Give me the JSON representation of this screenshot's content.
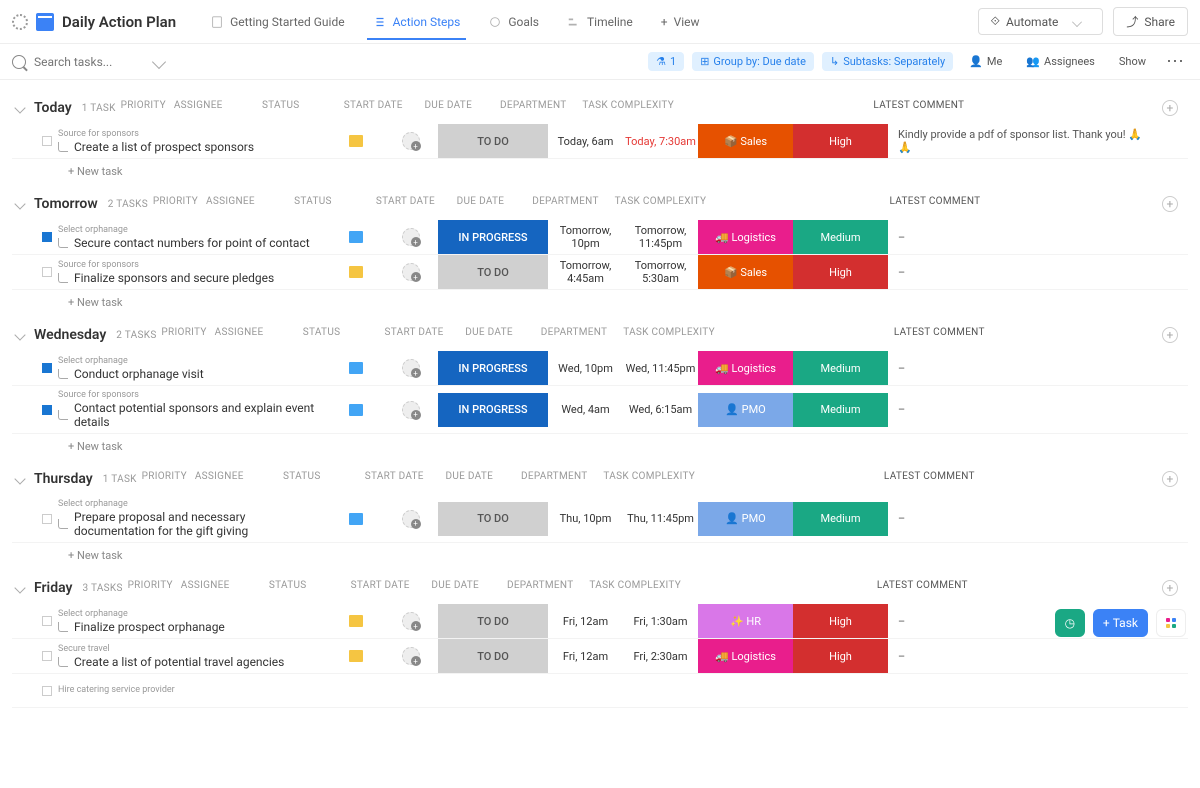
{
  "header": {
    "title": "Daily Action Plan",
    "tabs": [
      {
        "label": "Getting Started Guide"
      },
      {
        "label": "Action Steps"
      },
      {
        "label": "Goals"
      },
      {
        "label": "Timeline"
      },
      {
        "label": "View"
      }
    ],
    "automate": "Automate",
    "share": "Share"
  },
  "toolbar": {
    "search_placeholder": "Search tasks...",
    "filter_count": "1",
    "group_by": "Group by: Due date",
    "subtasks": "Subtasks: Separately",
    "me": "Me",
    "assignees": "Assignees",
    "show": "Show"
  },
  "columns": {
    "priority": "PRIORITY",
    "assignee": "ASSIGNEE",
    "status": "STATUS",
    "start": "START DATE",
    "due": "DUE DATE",
    "dept": "DEPARTMENT",
    "complexity": "TASK COMPLEXITY",
    "comment": "LATEST COMMENT"
  },
  "new_task": "+ New task",
  "groups": [
    {
      "title": "Today",
      "count": "1 TASK",
      "tasks": [
        {
          "parent": "Source for sponsors",
          "title": "Create a list of prospect sponsors",
          "flag": "yellow",
          "status": "TO DO",
          "status_cls": "st-todo",
          "start": "Today, 6am",
          "due": "Today, 7:30am",
          "due_red": true,
          "dept": "📦 Sales",
          "dept_cls": "dept-sales",
          "cx": "High",
          "cx_cls": "cx-high",
          "comment": "Kindly provide a pdf of sponsor list. Thank you! 🙏 🙏"
        }
      ]
    },
    {
      "title": "Tomorrow",
      "count": "2 TASKS",
      "tasks": [
        {
          "parent": "Select orphanage",
          "title": "Secure contact numbers for point of contact",
          "flag": "blue",
          "sq_blue": true,
          "status": "IN PROGRESS",
          "status_cls": "st-prog",
          "start": "Tomorrow, 10pm",
          "due": "Tomorrow, 11:45pm",
          "dept": "🚚 Logistics",
          "dept_cls": "dept-log",
          "cx": "Medium",
          "cx_cls": "cx-med",
          "comment": "–"
        },
        {
          "parent": "Source for sponsors",
          "title": "Finalize sponsors and secure pledges",
          "flag": "yellow",
          "status": "TO DO",
          "status_cls": "st-todo",
          "start": "Tomorrow, 4:45am",
          "due": "Tomorrow, 5:30am",
          "dept": "📦 Sales",
          "dept_cls": "dept-sales",
          "cx": "High",
          "cx_cls": "cx-high",
          "comment": "–"
        }
      ]
    },
    {
      "title": "Wednesday",
      "count": "2 TASKS",
      "tasks": [
        {
          "parent": "Select orphanage",
          "title": "Conduct orphanage visit",
          "flag": "blue",
          "sq_blue": true,
          "status": "IN PROGRESS",
          "status_cls": "st-prog",
          "start": "Wed, 10pm",
          "due": "Wed, 11:45pm",
          "dept": "🚚 Logistics",
          "dept_cls": "dept-log",
          "cx": "Medium",
          "cx_cls": "cx-med",
          "comment": "–"
        },
        {
          "parent": "Source for sponsors",
          "title": "Contact potential sponsors and explain event details",
          "flag": "blue",
          "sq_blue": true,
          "status": "IN PROGRESS",
          "status_cls": "st-prog",
          "start": "Wed, 4am",
          "due": "Wed, 6:15am",
          "dept": "👤 PMO",
          "dept_cls": "dept-pmo",
          "cx": "Medium",
          "cx_cls": "cx-med",
          "comment": "–"
        }
      ]
    },
    {
      "title": "Thursday",
      "count": "1 TASK",
      "tasks": [
        {
          "parent": "Select orphanage",
          "title": "Prepare proposal and necessary documentation for the gift giving",
          "flag": "blue",
          "status": "TO DO",
          "status_cls": "st-todo",
          "start": "Thu, 10pm",
          "due": "Thu, 11:45pm",
          "dept": "👤 PMO",
          "dept_cls": "dept-pmo",
          "cx": "Medium",
          "cx_cls": "cx-med",
          "comment": "–"
        }
      ]
    },
    {
      "title": "Friday",
      "count": "3 TASKS",
      "tasks": [
        {
          "parent": "Select orphanage",
          "title": "Finalize prospect orphanage",
          "flag": "yellow",
          "status": "TO DO",
          "status_cls": "st-todo",
          "start": "Fri, 12am",
          "due": "Fri, 1:30am",
          "dept": "✨ HR",
          "dept_cls": "dept-hr",
          "cx": "High",
          "cx_cls": "cx-high",
          "comment": "–"
        },
        {
          "parent": "Secure travel",
          "title": "Create a list of potential travel agencies",
          "flag": "yellow",
          "status": "TO DO",
          "status_cls": "st-todo",
          "start": "Fri, 12am",
          "due": "Fri, 2:30am",
          "dept": "🚚 Logistics",
          "dept_cls": "dept-log",
          "cx": "High",
          "cx_cls": "cx-high",
          "comment": "–"
        },
        {
          "parent": "Hire catering service provider",
          "title": "",
          "no_body": true
        }
      ]
    }
  ],
  "fab": {
    "task": "Task"
  }
}
